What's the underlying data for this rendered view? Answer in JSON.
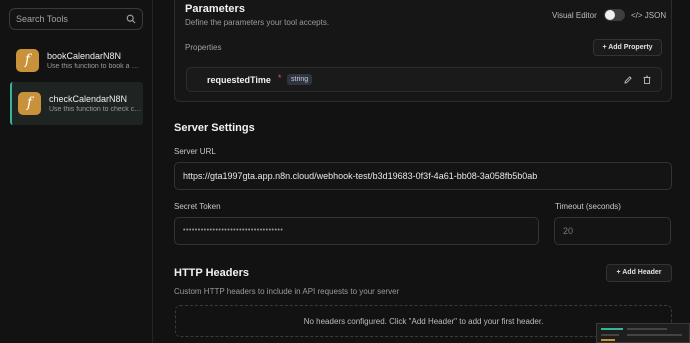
{
  "sidebar": {
    "search_placeholder": "Search Tools",
    "tools": [
      {
        "name": "bookCalendarN8N",
        "description": "Use this function to book a appointment",
        "icon": "function-icon",
        "selected": false
      },
      {
        "name": "checkCalendarN8N",
        "description": "Use this function to check calendar",
        "icon": "function-icon",
        "selected": true
      }
    ],
    "icon_glyph": "f"
  },
  "parameters": {
    "title": "Parameters",
    "subtitle": "Define the parameters your tool accepts.",
    "visual_editor_label": "Visual Editor",
    "json_label": "</> JSON",
    "properties_label": "Properties",
    "add_property_label": "+ Add Property",
    "property": {
      "name": "requestedTime",
      "required_mark": "*",
      "type": "string"
    }
  },
  "server_settings": {
    "title": "Server Settings",
    "url_label": "Server URL",
    "url_value": "https://gta1997gta.app.n8n.cloud/webhook-test/b3d19683-0f3f-4a61-bb08-3a058fb5b0ab",
    "secret_label": "Secret Token",
    "secret_value": "••••••••••••••••••••••••••••••••••",
    "timeout_label": "Timeout (seconds)",
    "timeout_placeholder": "20"
  },
  "http_headers": {
    "title": "HTTP Headers",
    "subtitle": "Custom HTTP headers to include in API requests to your server",
    "add_header_label": "+ Add Header",
    "empty_text": "No headers configured. Click \"Add Header\" to add your first header."
  },
  "colors": {
    "background": "#121212",
    "accent": "#3ab39c",
    "tool_icon": "#c8913a",
    "required": "#e05a5a"
  }
}
